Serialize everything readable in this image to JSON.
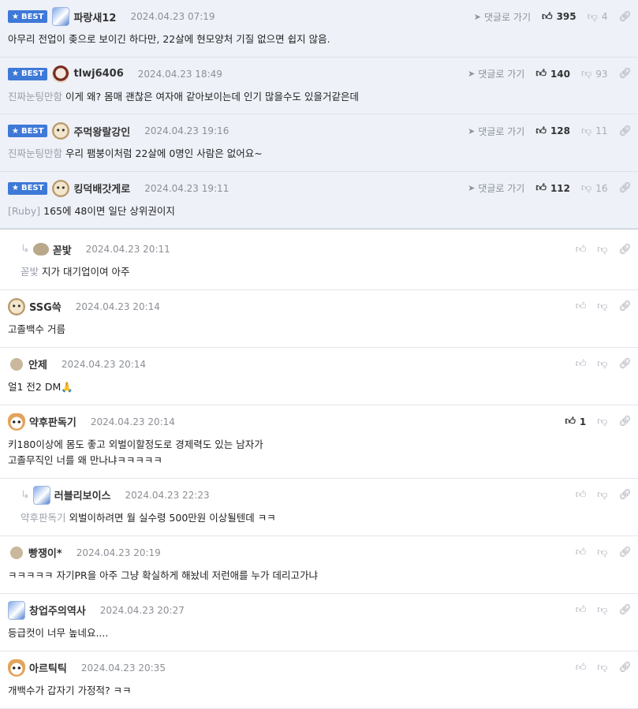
{
  "labels": {
    "best": "BEST",
    "goto": "댓글로 가기"
  },
  "best_comments": [
    {
      "nick": "파랑새12",
      "date": "2024.04.23 07:19",
      "likes": "395",
      "dislikes": "4",
      "mention": "",
      "text": "아무리 전업이 좆으로 보이긴 하다만, 22살에 현모양처 기질 없으면 쉽지 않음.",
      "avatar": "blue-bird-avatar"
    },
    {
      "nick": "tlwj6406",
      "date": "2024.04.23 18:49",
      "likes": "140",
      "dislikes": "93",
      "mention": "진짜눈팅만함",
      "text": "이게 왜? 몸매 괜찮은 여자애 같아보이는데 인기 많을수도 있을거같은데",
      "avatar": "eye-avatar"
    },
    {
      "nick": "주먹왕랄강인",
      "date": "2024.04.23 19:16",
      "likes": "128",
      "dislikes": "11",
      "mention": "진짜눈팅만함",
      "text": "우리 팸붕이처럼 22살에 0명인 사람은 없어요~",
      "avatar": "dog-avatar"
    },
    {
      "nick": "킹덕배갓게로",
      "date": "2024.04.23 19:11",
      "likes": "112",
      "dislikes": "16",
      "mention": "[Ruby]",
      "text": "165에 48이면 일단 상위권이지",
      "avatar": "dog-avatar"
    }
  ],
  "comments": [
    {
      "nick": "꼳밫",
      "date": "2024.04.23 20:11",
      "likes": "",
      "mention": "꼳밫",
      "text": "지가 대기업이여 아주",
      "avatar": "bean-avatar"
    },
    {
      "nick": "SSG쓱",
      "date": "2024.04.23 20:14",
      "likes": "",
      "mention": "",
      "text": "고졸백수 거름",
      "avatar": "dog-avatar"
    },
    {
      "nick": "안제",
      "date": "2024.04.23 20:14",
      "likes": "",
      "mention": "",
      "text": "얼1 전2 DM🙏",
      "avatar": "blob-avatar"
    },
    {
      "nick": "약후판독기",
      "date": "2024.04.23 20:14",
      "likes": "1",
      "mention": "",
      "text": "키180이상에 몸도 좋고 외벌이할정도로 경제력도 있는 남자가",
      "text2": "고졸무직인 너를 왜 만나냐ㅋㅋㅋㅋㅋ",
      "avatar": "fox-avatar"
    },
    {
      "nick": "러블리보이스",
      "date": "2024.04.23 22:23",
      "likes": "",
      "mention": "약후판독기",
      "text": "외벌이하려면 월 실수령 500만원 이상될텐데 ㅋㅋ",
      "avatar": "blue-bird-avatar"
    },
    {
      "nick": "빵쟁이*",
      "date": "2024.04.23 20:19",
      "likes": "",
      "mention": "",
      "text": "ㅋㅋㅋㅋㅋ 자기PR을 아주 그냥 확실하게 해놨네 저런애를 누가 데리고가냐",
      "avatar": "blob-avatar"
    },
    {
      "nick": "창업주의역사",
      "date": "2024.04.23 20:27",
      "likes": "",
      "mention": "",
      "text": "등급컷이 너무 높네요....",
      "avatar": "blue-bird-avatar"
    },
    {
      "nick": "아르틱틱",
      "date": "2024.04.23 20:35",
      "likes": "",
      "mention": "",
      "text": "개백수가 갑자기 가정적? ㅋㅋ",
      "avatar": "fox-avatar"
    }
  ]
}
